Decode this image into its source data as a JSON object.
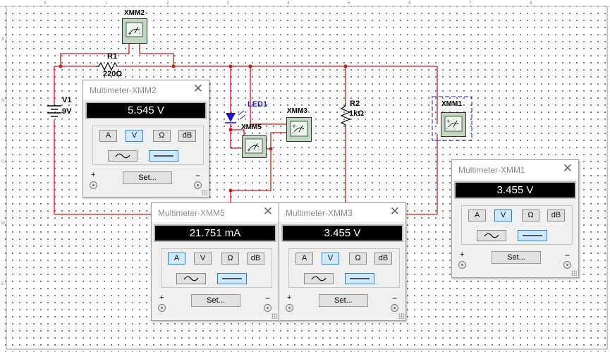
{
  "rulers": {
    "top": [
      "0",
      "1",
      "2",
      "3",
      "4",
      "5",
      "6",
      "7",
      "8"
    ],
    "left": [
      "A",
      "B",
      "C",
      "D",
      "E"
    ]
  },
  "components": {
    "xmm2": "XMM2",
    "r1": "R1",
    "r1_value": "220Ω",
    "v1": "V1",
    "v1_value": "9V",
    "led1": "LED1",
    "xmm5": "XMM5",
    "xmm3": "XMM3",
    "r2": "R2",
    "r2_value": "1kΩ",
    "xmm1": "XMM1"
  },
  "meters": [
    {
      "title": "Multimeter-XMM2",
      "reading": "5.545 V",
      "mode": "V"
    },
    {
      "title": "Multimeter-XMM5",
      "reading": "21.751 mA",
      "mode": "A"
    },
    {
      "title": "Multimeter-XMM3",
      "reading": "3.455 V",
      "mode": "V"
    },
    {
      "title": "Multimeter-XMM1",
      "reading": "3.455 V",
      "mode": "V"
    }
  ],
  "meter_controls": {
    "modes": [
      "A",
      "V",
      "Ω",
      "dB"
    ],
    "set_label": "Set...",
    "plus": "+",
    "minus": "−",
    "close": "✕",
    "wave_selected": "dc"
  },
  "colors": {
    "wire": "#d01818",
    "led": "#1616d8",
    "selection": "#1a1ad0",
    "display_bg": "#000000",
    "active_button": "#cde8ff"
  }
}
